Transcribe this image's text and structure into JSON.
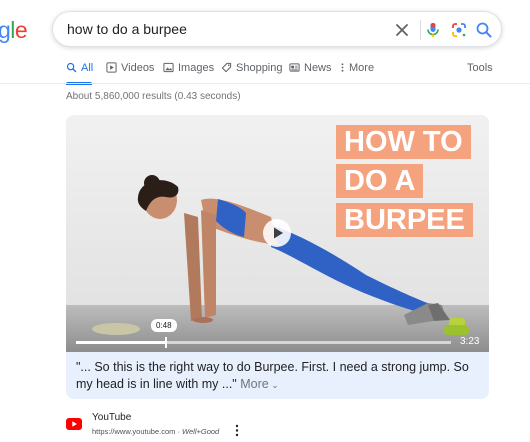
{
  "logo": {
    "text_g": "g",
    "text_l": "l",
    "text_e": "e"
  },
  "search": {
    "query": "how to do a burpee"
  },
  "tabs": [
    {
      "label": "All",
      "icon": "search-icon",
      "active": true
    },
    {
      "label": "Videos",
      "icon": "play-icon"
    },
    {
      "label": "Images",
      "icon": "image-icon"
    },
    {
      "label": "Shopping",
      "icon": "tag-icon"
    },
    {
      "label": "News",
      "icon": "news-icon"
    },
    {
      "label": "More",
      "icon": "more-vert-icon"
    }
  ],
  "tools_label": "Tools",
  "result_stats": "About 5,860,000 results (0.43 seconds)",
  "video": {
    "thumbnail_title": [
      "HOW TO",
      "DO A",
      "BURPEE"
    ],
    "current_time": "0:48",
    "duration": "3:23",
    "progress_fraction": 0.24,
    "snippet": "\"... So this is the right way to do Burpee. First. I need a strong jump. So my head is in line with my ...\"",
    "more_label": "More"
  },
  "source": {
    "name": "YouTube",
    "url": "https://www.youtube.com",
    "separator": " · ",
    "channel": "Well+Good"
  },
  "colors": {
    "accent": "#1a73e8",
    "title_box": "#f4a37e",
    "card_bg": "#e9f0fd"
  }
}
